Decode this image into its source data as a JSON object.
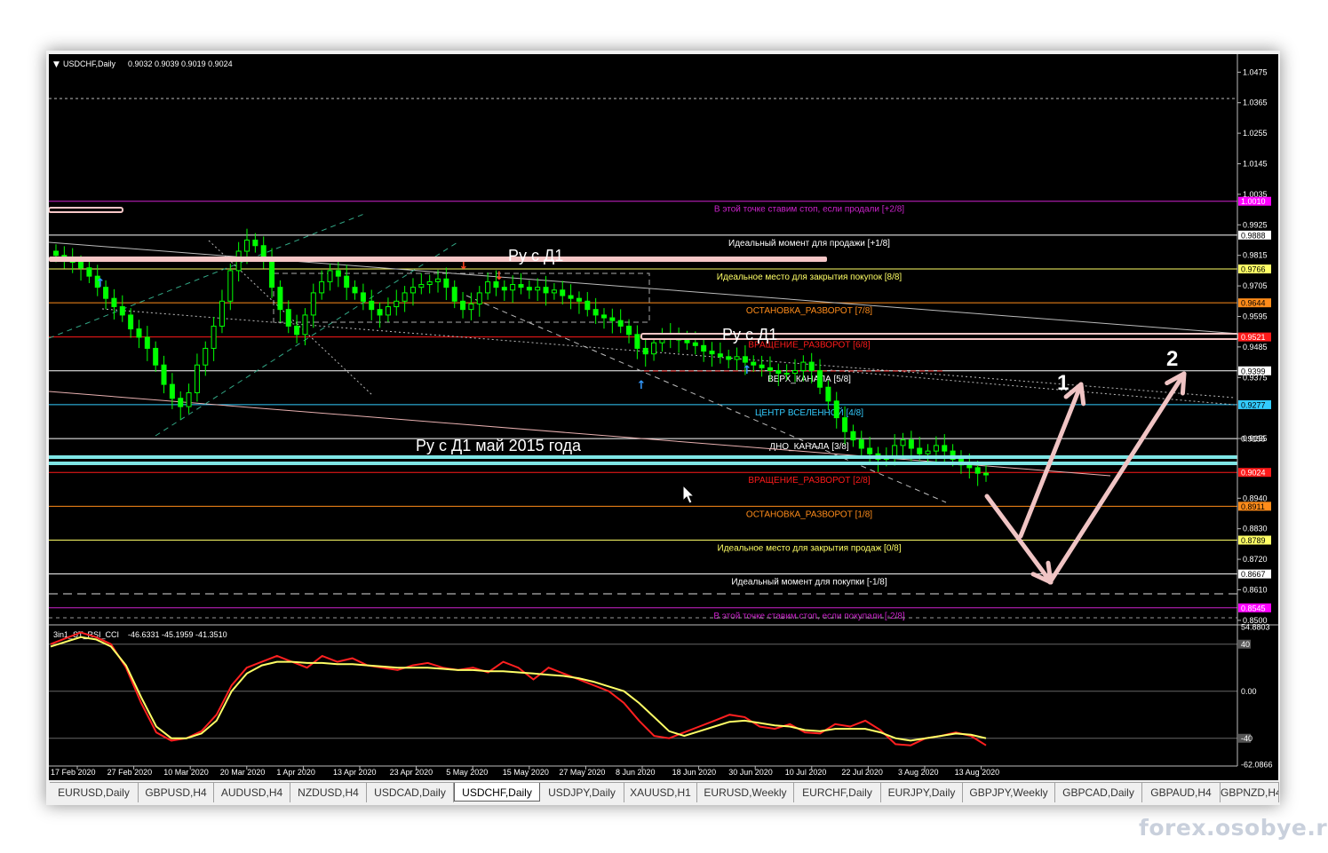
{
  "chart_title": {
    "symbol": "USDCHF,Daily",
    "ohlc": "0.9032 0.9039 0.9019 0.9024"
  },
  "indicator_title": {
    "name": "3in1_ST_RSI_CCI",
    "values": "-46.6331 -45.1959 -41.3510"
  },
  "colors": {
    "background": "#000000",
    "candle": "#00ff00",
    "signal_line": "#ffff66",
    "main_line": "#ff2020",
    "annotation": "#f6c6c6",
    "trend": "#cccccc"
  },
  "murrey_levels": [
    {
      "price": 1.001,
      "price_label": "1.0010",
      "color": "#cc22cc",
      "text": "В этой точке ставим стоп, если продали [+2/8]",
      "tag_color": "#ff00ff",
      "tag_text": "#ffffff"
    },
    {
      "price": 0.9888,
      "price_label": "0.9888",
      "color": "#ffffff",
      "text": "Идеальный момент для продажи [+1/8]",
      "tag_color": "#ffffff",
      "tag_text": "#000000"
    },
    {
      "price": 0.9766,
      "price_label": "0.9766",
      "color": "#ffff66",
      "text": "Идеальное место для закрытия покупок [8/8]",
      "tag_color": "#ffff66",
      "tag_text": "#000000"
    },
    {
      "price": 0.9644,
      "price_label": "0.9644",
      "color": "#ff8c1a",
      "text": "ОСТАНОВКА_РАЗВОРОТ [7/8]",
      "tag_color": "#ff8c1a",
      "tag_text": "#000000"
    },
    {
      "price": 0.9521,
      "price_label": "0.9521",
      "color": "#ff1a1a",
      "text": "ВРАЩЕНИЕ_РАЗВОРОТ [6/8]",
      "tag_color": "#ff1a1a",
      "tag_text": "#ffffff"
    },
    {
      "price": 0.9399,
      "price_label": "0.9399",
      "color": "#ffffff",
      "text": "ВЕРХ_КАНАЛА [5/8]",
      "tag_color": "#ffffff",
      "tag_text": "#000000"
    },
    {
      "price": 0.9277,
      "price_label": "0.9277",
      "color": "#33ccff",
      "text": "ЦЕНТР ВСЕЛЕННОЙ [4/8]",
      "tag_color": "#33ccff",
      "tag_text": "#000000"
    },
    {
      "price": 0.9155,
      "price_label": "0.9155",
      "color": "#ffffff",
      "text": "ДНО_КАНАЛА [3/8]",
      "tag_color": null,
      "tag_text": null
    },
    {
      "price": 0.9033,
      "price_label": "0.9024",
      "color": "#ff1a1a",
      "text": "ВРАЩЕНИЕ_РАЗВОРОТ [2/8]",
      "tag_color": "#ff1a1a",
      "tag_text": "#ffffff"
    },
    {
      "price": 0.8911,
      "price_label": "0.8911",
      "color": "#ff8c1a",
      "text": "ОСТАНОВКА_РАЗВОРОТ [1/8]",
      "tag_color": "#ff8c1a",
      "tag_text": "#000000"
    },
    {
      "price": 0.8789,
      "price_label": "0.8789",
      "color": "#ffff66",
      "text": "Идеальное место для закрытия продаж [0/8]",
      "tag_color": "#ffff66",
      "tag_text": "#000000"
    },
    {
      "price": 0.8667,
      "price_label": "0.8667",
      "color": "#ffffff",
      "text": "Идеальный момент для покупки [-1/8]",
      "tag_color": "#ffffff",
      "tag_text": "#000000"
    },
    {
      "price": 0.8545,
      "price_label": "0.8545",
      "color": "#cc22cc",
      "text": "В этой точке ставим стоп, если покупали [-2/8]",
      "tag_color": "#ff00ff",
      "tag_text": "#ffffff"
    }
  ],
  "annotations": {
    "label_top": "Ру с Д1",
    "label_mid": "Ру с Д1",
    "label_bottom": "Ру с Д1 май 2015 года",
    "arrow_1": "1",
    "arrow_2": "2"
  },
  "chart_data": [
    {
      "type": "candlestick",
      "title": "USDCHF,Daily",
      "y_ticks": [
        "1.0475",
        "1.0365",
        "1.0255",
        "1.0145",
        "1.0035",
        "0.9925",
        "0.9815",
        "0.9705",
        "0.9595",
        "0.9485",
        "0.9375",
        "0.9155",
        "0.8940",
        "0.8830",
        "0.8720",
        "0.8610",
        "0.8500"
      ],
      "x_ticks": [
        "17 Feb 2020",
        "27 Feb 2020",
        "10 Mar 2020",
        "20 Mar 2020",
        "1 Apr 2020",
        "13 Apr 2020",
        "23 Apr 2020",
        "5 May 2020",
        "15 May 2020",
        "27 May 2020",
        "8 Jun 2020",
        "18 Jun 2020",
        "30 Jun 2020",
        "10 Jul 2020",
        "22 Jul 2020",
        "3 Aug 2020",
        "13 Aug 2020"
      ],
      "ylim": [
        0.849,
        1.054
      ],
      "close": [
        0.9815,
        0.98,
        0.979,
        0.977,
        0.974,
        0.97,
        0.966,
        0.963,
        0.96,
        0.955,
        0.952,
        0.948,
        0.942,
        0.935,
        0.93,
        0.927,
        0.932,
        0.942,
        0.948,
        0.956,
        0.965,
        0.976,
        0.983,
        0.987,
        0.985,
        0.98,
        0.97,
        0.962,
        0.956,
        0.953,
        0.96,
        0.968,
        0.972,
        0.976,
        0.974,
        0.97,
        0.968,
        0.965,
        0.962,
        0.96,
        0.963,
        0.965,
        0.968,
        0.97,
        0.971,
        0.972,
        0.973,
        0.97,
        0.965,
        0.962,
        0.964,
        0.968,
        0.972,
        0.97,
        0.969,
        0.971,
        0.97,
        0.969,
        0.97,
        0.968,
        0.969,
        0.967,
        0.966,
        0.965,
        0.962,
        0.96,
        0.959,
        0.958,
        0.956,
        0.953,
        0.948,
        0.946,
        0.95,
        0.952,
        0.953,
        0.951,
        0.95,
        0.949,
        0.947,
        0.946,
        0.945,
        0.944,
        0.945,
        0.943,
        0.942,
        0.941,
        0.94,
        0.939,
        0.939,
        0.94,
        0.943,
        0.94,
        0.934,
        0.929,
        0.923,
        0.918,
        0.915,
        0.912,
        0.91,
        0.908,
        0.909,
        0.913,
        0.915,
        0.912,
        0.91,
        0.911,
        0.913,
        0.911,
        0.908,
        0.906,
        0.905,
        0.903,
        0.9024
      ]
    },
    {
      "type": "line",
      "title": "3in1_ST_RSI_CCI",
      "y_ticks": [
        "54.8803",
        "40",
        "0.00",
        "-40",
        "-62.0866"
      ],
      "ylim": [
        -62.0866,
        54.8803
      ],
      "series": [
        {
          "values": [
            40,
            45,
            50,
            46,
            40,
            20,
            -10,
            -35,
            -42,
            -40,
            -34,
            -20,
            5,
            20,
            25,
            30,
            25,
            20,
            30,
            25,
            28,
            22,
            20,
            18,
            22,
            24,
            20,
            18,
            20,
            16,
            25,
            20,
            10,
            20,
            15,
            10,
            5,
            0,
            -10,
            -25,
            -38,
            -40,
            -35,
            -30,
            -25,
            -20,
            -22,
            -30,
            -32,
            -28,
            -35,
            -36,
            -28,
            -30,
            -25,
            -33,
            -45,
            -46,
            -40,
            -38,
            -35,
            -38,
            -46
          ]
        },
        {
          "values": [
            38,
            42,
            46,
            44,
            38,
            22,
            -5,
            -30,
            -40,
            -40,
            -36,
            -25,
            0,
            15,
            22,
            25,
            25,
            24,
            24,
            23,
            23,
            22,
            21,
            20,
            20,
            20,
            19,
            18,
            18,
            17,
            17,
            16,
            15,
            14,
            13,
            11,
            8,
            4,
            0,
            -10,
            -22,
            -34,
            -38,
            -34,
            -30,
            -26,
            -25,
            -27,
            -29,
            -30,
            -33,
            -34,
            -32,
            -32,
            -32,
            -35,
            -40,
            -42,
            -40,
            -38,
            -36,
            -37,
            -40
          ]
        }
      ]
    }
  ],
  "tabs": [
    {
      "label": "EURUSD,Daily",
      "active": false
    },
    {
      "label": "GBPUSD,H4",
      "active": false
    },
    {
      "label": "AUDUSD,H4",
      "active": false
    },
    {
      "label": "NZDUSD,H4",
      "active": false
    },
    {
      "label": "USDCAD,Daily",
      "active": false
    },
    {
      "label": "USDCHF,Daily",
      "active": true
    },
    {
      "label": "USDJPY,Daily",
      "active": false
    },
    {
      "label": "XAUUSD,H1",
      "active": false
    },
    {
      "label": "EURUSD,Weekly",
      "active": false
    },
    {
      "label": "EURCHF,Daily",
      "active": false
    },
    {
      "label": "EURJPY,Daily",
      "active": false
    },
    {
      "label": "GBPJPY,Weekly",
      "active": false
    },
    {
      "label": "GBPCAD,Daily",
      "active": false
    },
    {
      "label": "GBPAUD,H4",
      "active": false
    },
    {
      "label": "GBPNZD,H4",
      "active": false
    }
  ],
  "watermark": "forex.osobye.ru"
}
